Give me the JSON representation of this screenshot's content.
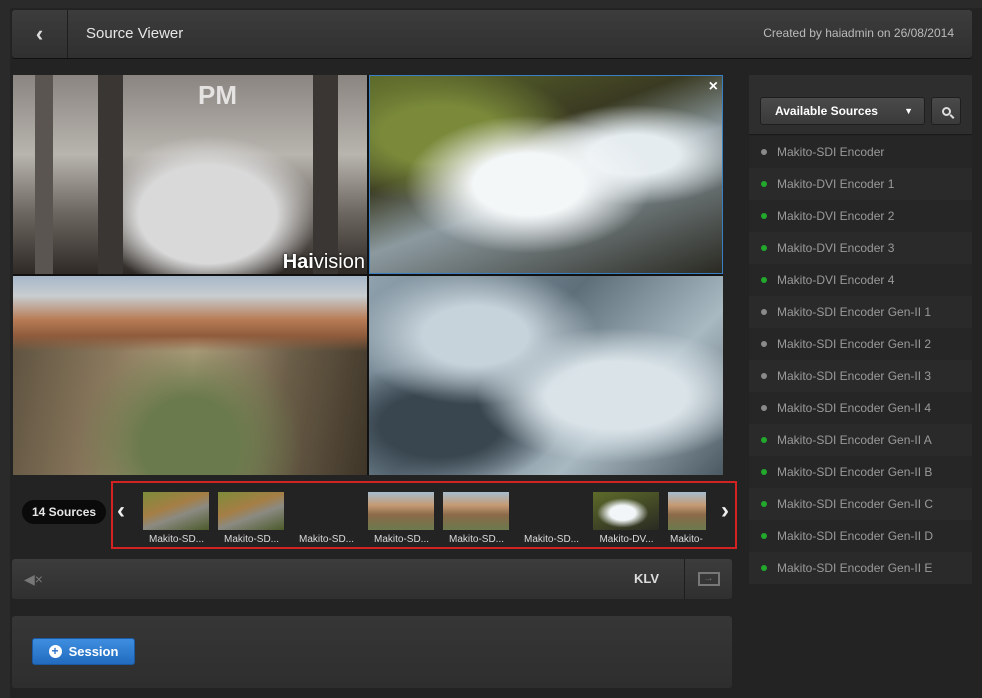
{
  "header": {
    "back_icon": "chevron-left-icon",
    "title": "Source Viewer",
    "created": "Created by haiadmin on 26/08/2014"
  },
  "video": {
    "tile1_sign": "PM",
    "tile1_brand_bold": "Hai",
    "tile1_brand_rest": "vision",
    "close_label": "×"
  },
  "strip": {
    "count": "14 Sources",
    "thumbs": [
      {
        "label": "Makito-SD...",
        "kind": "road"
      },
      {
        "label": "Makito-SD...",
        "kind": "road"
      },
      {
        "label": "Makito-SD...",
        "kind": "camera"
      },
      {
        "label": "Makito-SD...",
        "kind": "desert"
      },
      {
        "label": "Makito-SD...",
        "kind": "desert"
      },
      {
        "label": "Makito-SD...",
        "kind": "camera"
      },
      {
        "label": "Makito-DV...",
        "kind": "water"
      },
      {
        "label": "Makito-",
        "kind": "desert"
      }
    ],
    "prev_label": "‹",
    "next_label": "›"
  },
  "controls": {
    "mute_label": "◀×",
    "klv_label": "KLV",
    "screen_icon_label": "→"
  },
  "session": {
    "button_label": "Session",
    "plus_label": "+"
  },
  "sidebar": {
    "dropdown_label": "Available Sources",
    "caret": "▼",
    "colors": {
      "green": "#22a82a",
      "grey": "#8a8a8a"
    },
    "sources": [
      {
        "name": "Makito-SDI Encoder",
        "status": "grey"
      },
      {
        "name": "Makito-DVI Encoder 1",
        "status": "green"
      },
      {
        "name": "Makito-DVI Encoder 2",
        "status": "green"
      },
      {
        "name": "Makito-DVI Encoder 3",
        "status": "green"
      },
      {
        "name": "Makito-DVI Encoder 4",
        "status": "green"
      },
      {
        "name": "Makito-SDI Encoder Gen-II 1",
        "status": "grey"
      },
      {
        "name": "Makito-SDI Encoder Gen-II 2",
        "status": "grey"
      },
      {
        "name": "Makito-SDI Encoder Gen-II 3",
        "status": "grey"
      },
      {
        "name": "Makito-SDI Encoder Gen-II 4",
        "status": "grey"
      },
      {
        "name": "Makito-SDI Encoder Gen-II A",
        "status": "green"
      },
      {
        "name": "Makito-SDI Encoder Gen-II B",
        "status": "green"
      },
      {
        "name": "Makito-SDI Encoder Gen-II C",
        "status": "green"
      },
      {
        "name": "Makito-SDI Encoder Gen-II D",
        "status": "green"
      },
      {
        "name": "Makito-SDI Encoder Gen-II E",
        "status": "green"
      }
    ]
  }
}
